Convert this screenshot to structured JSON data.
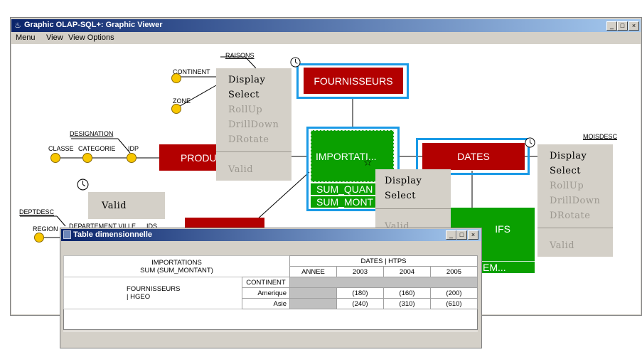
{
  "window": {
    "title": "Graphic OLAP-SQL+: Graphic Viewer",
    "min_btn": "_",
    "max_btn": "□",
    "close_btn": "×"
  },
  "menu": {
    "items": [
      "Menu",
      "View",
      "View Options"
    ]
  },
  "diagram": {
    "nodes": {
      "fournisseurs": "FOURNISSEURS",
      "produits": "PRODU",
      "importations": "IMPORTATI...",
      "dates": "DATES",
      "measure1": "SUM_QUAN",
      "measure2": "SUM_MONT",
      "tarifs": "IFS",
      "tarifs_bottom": "EM..."
    },
    "labels": {
      "raisons": "RAISONS",
      "continent": "CONTINENT",
      "zone": "ZONE",
      "designation": "DESIGNATION",
      "classe": "CLASSE",
      "categorie": "CATEGORIE",
      "idp": "IDP",
      "deptdesc": "DEPTDESC",
      "region": "REGION",
      "departement_ville": "DEPARTEMENT VILLE",
      "ids": "IDS",
      "moisdesc": "MOISDESC"
    }
  },
  "popups": {
    "fournisseurs_menu": [
      "Display",
      "Select",
      "RollUp",
      "DrillDown",
      "DRotate",
      "Valid"
    ],
    "dates_menu": [
      "Display",
      "Select",
      "RollUp",
      "DrillDown",
      "DRotate",
      "Valid"
    ],
    "importations_menu": [
      "Display",
      "Select",
      "Valid"
    ],
    "valid_box": "Valid"
  },
  "table_window": {
    "title": "Table dimensionnelle",
    "min_btn": "_",
    "max_btn": "□",
    "close_btn": "×",
    "header": {
      "fact": "IMPORTATIONS",
      "measure": "SUM (SUM_MONTANT)",
      "dimension": "DATES | HTPS",
      "columns": [
        "ANNEE",
        "2003",
        "2004",
        "2005"
      ]
    },
    "rows_dimension": "FOURNISSEURS",
    "rows_hierarchy": "| HGEO",
    "level": "CONTINENT",
    "rows": [
      {
        "label": "Amerique",
        "values": [
          "(180)",
          "(160)",
          "(200)"
        ]
      },
      {
        "label": "Asie",
        "values": [
          "(240)",
          "(310)",
          "(610)"
        ]
      }
    ]
  },
  "colors": {
    "dimension_red": "#b30000",
    "fact_green": "#0aa000",
    "selection_blue": "#1a9ae6",
    "attribute_yellow": "#f8c700",
    "titlebar_blue": "#0a246a"
  }
}
